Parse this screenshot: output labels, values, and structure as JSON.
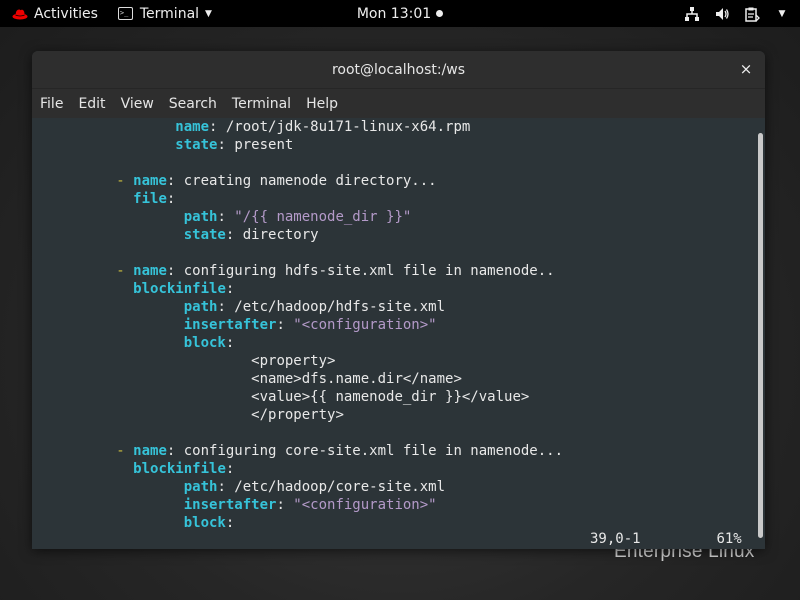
{
  "topbar": {
    "activities": "Activities",
    "app_menu": "Terminal",
    "clock": "Mon 13:01",
    "icons": [
      "network-icon",
      "volume-icon",
      "clipboard-icon",
      "power-menu-caret"
    ]
  },
  "watermark": "Enterprise Linux",
  "window": {
    "title": "root@localhost:/ws",
    "close_glyph": "×",
    "menu": [
      "File",
      "Edit",
      "View",
      "Search",
      "Terminal",
      "Help"
    ]
  },
  "terminal": {
    "lines": [
      {
        "indent": "                 ",
        "key": "name",
        "sep": ": ",
        "val": "/root/jdk-8u171-linux-x64.rpm",
        "val_style": "plain"
      },
      {
        "indent": "                 ",
        "key": "state",
        "sep": ": ",
        "val": "present",
        "val_style": "plain"
      },
      {
        "indent": "",
        "key": "",
        "sep": "",
        "val": "",
        "val_style": "plain"
      },
      {
        "indent": "          ",
        "dash": "- ",
        "key": "name",
        "sep": ": ",
        "val": "creating namenode directory...",
        "val_style": "plain"
      },
      {
        "indent": "            ",
        "key": "file",
        "sep": ":",
        "val": "",
        "val_style": "plain"
      },
      {
        "indent": "                  ",
        "key": "path",
        "sep": ": ",
        "val": "\"/{{ namenode_dir }}\"",
        "val_style": "string"
      },
      {
        "indent": "                  ",
        "key": "state",
        "sep": ": ",
        "val": "directory",
        "val_style": "plain"
      },
      {
        "indent": "",
        "key": "",
        "sep": "",
        "val": "",
        "val_style": "plain"
      },
      {
        "indent": "          ",
        "dash": "- ",
        "key": "name",
        "sep": ": ",
        "val": "configuring hdfs-site.xml file in namenode..",
        "val_style": "plain"
      },
      {
        "indent": "            ",
        "key": "blockinfile",
        "sep": ":",
        "val": "",
        "val_style": "plain"
      },
      {
        "indent": "                  ",
        "key": "path",
        "sep": ": ",
        "val": "/etc/hadoop/hdfs-site.xml",
        "val_style": "plain"
      },
      {
        "indent": "                  ",
        "key": "insertafter",
        "sep": ": ",
        "val": "\"<configuration>\"",
        "val_style": "string"
      },
      {
        "indent": "                  ",
        "key": "block",
        "sep": ":",
        "val": "",
        "val_style": "plain"
      },
      {
        "indent": "                          ",
        "key": "",
        "sep": "",
        "val": "<property>",
        "val_style": "plain"
      },
      {
        "indent": "                          ",
        "key": "",
        "sep": "",
        "val": "<name>dfs.name.dir</name>",
        "val_style": "plain"
      },
      {
        "indent": "                          ",
        "key": "",
        "sep": "",
        "val": "<value>{{ namenode_dir }}</value>",
        "val_style": "plain"
      },
      {
        "indent": "                          ",
        "key": "",
        "sep": "",
        "val": "</property>",
        "val_style": "plain"
      },
      {
        "indent": "",
        "key": "",
        "sep": "",
        "val": "",
        "val_style": "plain"
      },
      {
        "indent": "          ",
        "dash": "- ",
        "key": "name",
        "sep": ": ",
        "val": "configuring core-site.xml file in namenode...",
        "val_style": "plain"
      },
      {
        "indent": "            ",
        "key": "blockinfile",
        "sep": ":",
        "val": "",
        "val_style": "plain"
      },
      {
        "indent": "                  ",
        "key": "path",
        "sep": ": ",
        "val": "/etc/hadoop/core-site.xml",
        "val_style": "plain"
      },
      {
        "indent": "                  ",
        "key": "insertafter",
        "sep": ": ",
        "val": "\"<configuration>\"",
        "val_style": "string"
      },
      {
        "indent": "                  ",
        "key": "block",
        "sep": ":",
        "val": "",
        "val_style": "plain"
      }
    ],
    "status_position": "39,0-1",
    "status_percent": "61%",
    "scroll_fraction": 0.61
  },
  "colors": {
    "key": "#36c3d9",
    "string": "#b49ac9",
    "dash": "#c9bb3e",
    "terminal_bg": "#2c3438"
  }
}
